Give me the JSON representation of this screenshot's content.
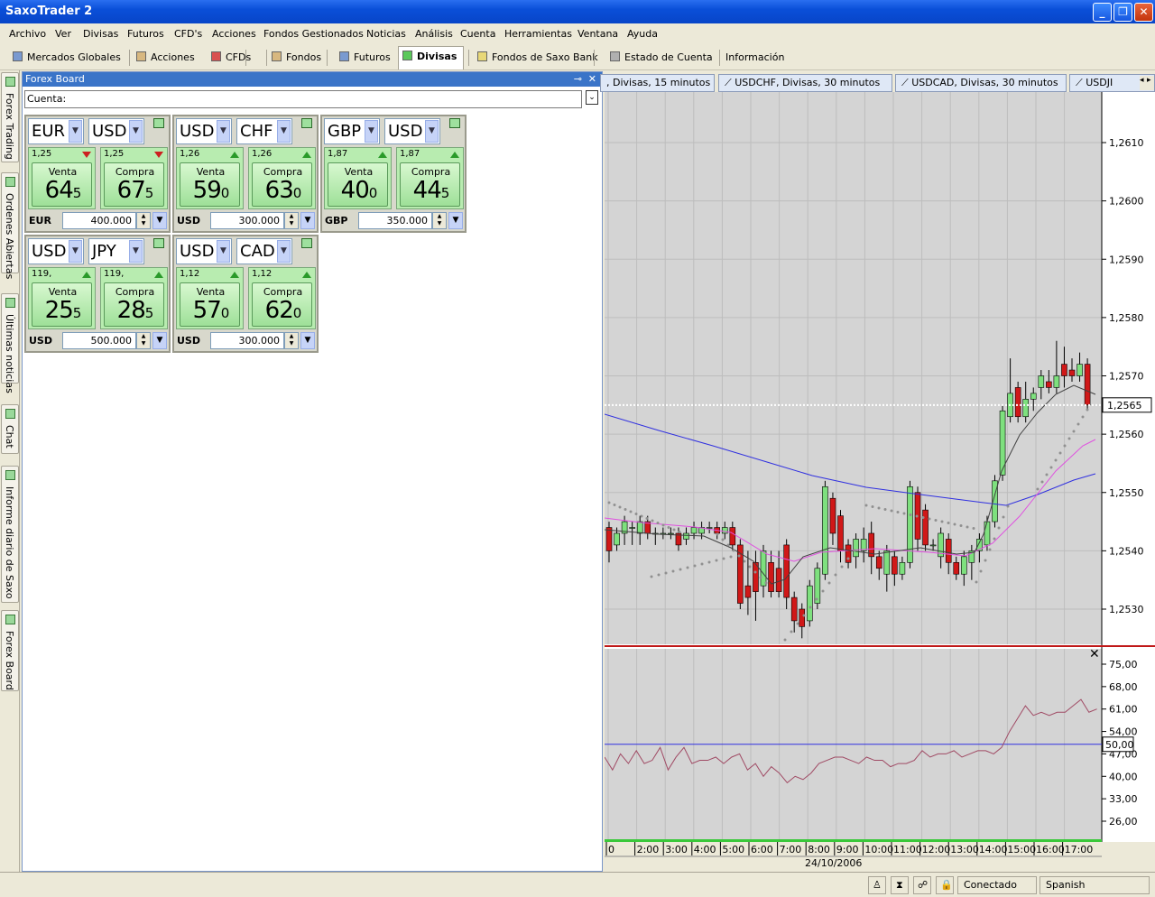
{
  "window": {
    "title": "SaxoTrader 2"
  },
  "menu": [
    "Archivo",
    "Ver",
    "Divisas",
    "Futuros",
    "CFD's",
    "Acciones",
    "Fondos Gestionados",
    "Noticias",
    "Análisis",
    "Cuenta",
    "Herramientas",
    "Ventana",
    "Ayuda"
  ],
  "tabs": [
    "Mercados Globales",
    "Acciones",
    "CFDs",
    "Fondos",
    "Futuros",
    "Divisas",
    "Fondos de Saxo Bank",
    "Estado de Cuenta",
    "Información"
  ],
  "active_tab": "Divisas",
  "side_tabs": [
    "Forex Trading",
    "Ordenes Abiertas",
    "Últimas noticias",
    "Chat",
    "Informe diario de Saxo",
    "Forex Board"
  ],
  "forex_board": {
    "title": "Forex Board",
    "account_label": "Cuenta:",
    "tiles": [
      {
        "base": "EUR",
        "quote": "USD",
        "sell_small": "1,25",
        "sell_dir": "down",
        "sell_label": "Venta",
        "sell_big": "64",
        "sell_pip": "5",
        "buy_small": "1,25",
        "buy_dir": "down",
        "buy_label": "Compra",
        "buy_big": "67",
        "buy_pip": "5",
        "amount_ccy": "EUR",
        "amount": "400.000"
      },
      {
        "base": "USD",
        "quote": "CHF",
        "sell_small": "1,26",
        "sell_dir": "up",
        "sell_label": "Venta",
        "sell_big": "59",
        "sell_pip": "0",
        "buy_small": "1,26",
        "buy_dir": "up",
        "buy_label": "Compra",
        "buy_big": "63",
        "buy_pip": "0",
        "amount_ccy": "USD",
        "amount": "300.000"
      },
      {
        "base": "GBP",
        "quote": "USD",
        "sell_small": "1,87",
        "sell_dir": "up",
        "sell_label": "Venta",
        "sell_big": "40",
        "sell_pip": "0",
        "buy_small": "1,87",
        "buy_dir": "up",
        "buy_label": "Compra",
        "buy_big": "44",
        "buy_pip": "5",
        "amount_ccy": "GBP",
        "amount": "350.000"
      },
      {
        "base": "USD",
        "quote": "JPY",
        "sell_small": "119,",
        "sell_dir": "up",
        "sell_label": "Venta",
        "sell_big": "25",
        "sell_pip": "5",
        "buy_small": "119,",
        "buy_dir": "up",
        "buy_label": "Compra",
        "buy_big": "28",
        "buy_pip": "5",
        "amount_ccy": "USD",
        "amount": "500.000"
      },
      {
        "base": "USD",
        "quote": "CAD",
        "sell_small": "1,12",
        "sell_dir": "up",
        "sell_label": "Venta",
        "sell_big": "57",
        "sell_pip": "0",
        "buy_small": "1,12",
        "buy_dir": "up",
        "buy_label": "Compra",
        "buy_big": "62",
        "buy_pip": "0",
        "amount_ccy": "USD",
        "amount": "300.000"
      }
    ]
  },
  "chart_tabs": [
    ", Divisas, 15 minutos",
    "USDCHF, Divisas, 30 minutos",
    "USDCAD, Divisas, 30 minutos",
    "USDJI"
  ],
  "chart": {
    "price_ticks": [
      "1,2610",
      "1,2600",
      "1,2590",
      "1,2580",
      "1,2570",
      "1,2560",
      "1,2550",
      "1,2540",
      "1,2530"
    ],
    "current_price": "1,2565",
    "osc_ticks": [
      "75,00",
      "68,00",
      "61,00",
      "54,00",
      "47,00",
      "40,00",
      "33,00",
      "26,00"
    ],
    "osc_level": "50,00",
    "time_ticks": [
      "0",
      "2:00",
      "3:00",
      "4:00",
      "5:00",
      "6:00",
      "7:00",
      "8:00",
      "9:00",
      "10:00",
      "11:00",
      "12:00",
      "13:00",
      "14:00",
      "15:00",
      "16:00",
      "17:00"
    ],
    "date": "24/10/2006",
    "colors": {
      "up": "#7ee07e",
      "down": "#d01818",
      "ma_fast": "#404040",
      "ma_mid": "#e050e0",
      "ma_slow": "#3030e0",
      "sar": "#909090",
      "rsi": "#a04a64",
      "grid": "#bdbdbd",
      "bg": "#d4d4d4"
    }
  },
  "status": {
    "connection": "Conectado",
    "language": "Spanish"
  }
}
